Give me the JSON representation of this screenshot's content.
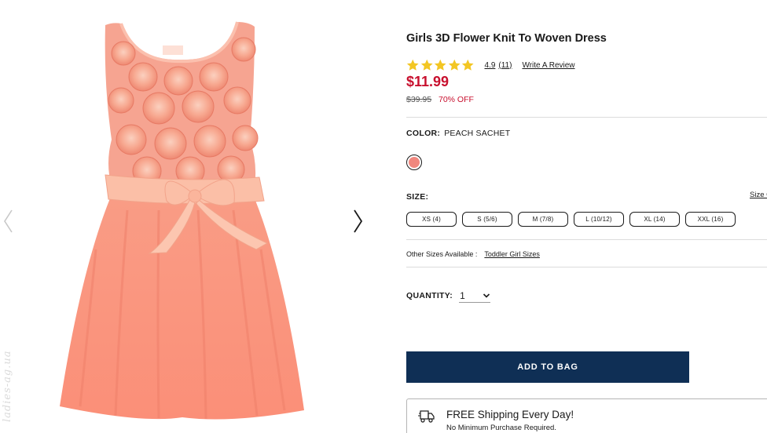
{
  "product": {
    "title": "Girls 3D Flower Knit To Woven Dress",
    "rating_value": "4.9",
    "rating_count": "(11)",
    "write_review": "Write A Review",
    "price": "$11.99",
    "original_price": "$39.95",
    "discount": "70% OFF",
    "rating_stars": 5
  },
  "color": {
    "label": "COLOR:",
    "value": "PEACH SACHET",
    "swatch_hex": "#f0877e"
  },
  "size": {
    "label": "SIZE:",
    "guide_link": "Size G",
    "options": [
      "XS (4)",
      "S (5/6)",
      "M (7/8)",
      "L (10/12)",
      "XL (14)",
      "XXL (16)"
    ]
  },
  "other_sizes": {
    "label": "Other Sizes Available :",
    "link": "Toddler Girl Sizes"
  },
  "quantity": {
    "label": "QUANTITY:",
    "value": "1"
  },
  "actions": {
    "add_to_bag": "ADD TO BAG"
  },
  "shipping": {
    "title": "FREE Shipping Every Day!",
    "subtitle": "No Minimum Purchase Required."
  },
  "watermark": "ladies-ag.ua",
  "colors": {
    "brand_navy": "#0f2f55",
    "sale_red": "#c8102e",
    "star_yellow": "#f3c623"
  }
}
